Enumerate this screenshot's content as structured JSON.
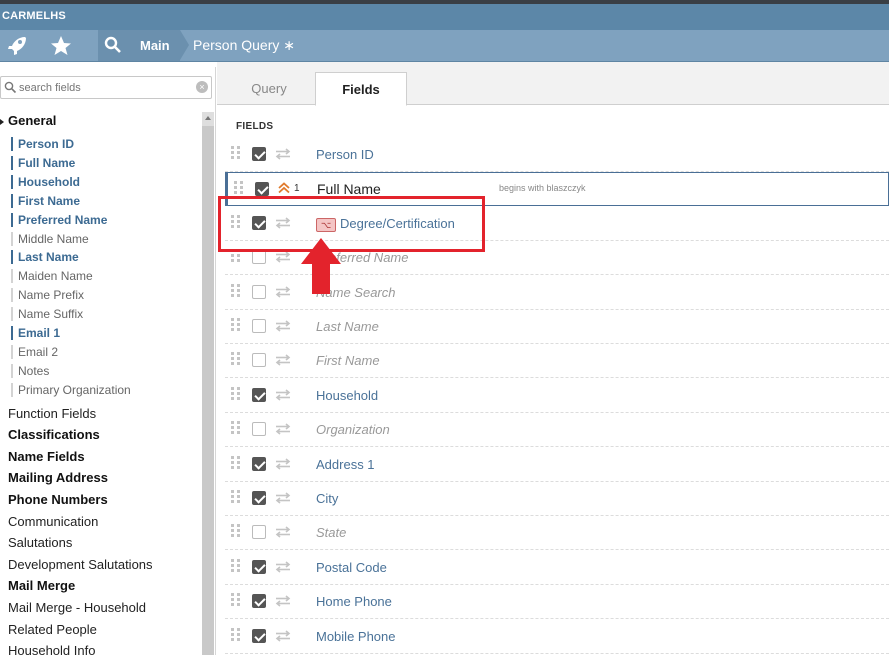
{
  "app": {
    "title": "CARMELHS"
  },
  "nav": {
    "main_label": "Main",
    "page_label": "Person Query ∗",
    "icons": [
      "rocket-icon",
      "star-icon",
      "search-icon"
    ]
  },
  "sidebar": {
    "search_placeholder": "search fields",
    "general_label": "General",
    "general_items": [
      {
        "label": "Person ID",
        "selected": true
      },
      {
        "label": "Full Name",
        "selected": true
      },
      {
        "label": "Household",
        "selected": true
      },
      {
        "label": "First Name",
        "selected": true
      },
      {
        "label": "Preferred Name",
        "selected": true
      },
      {
        "label": "Middle Name",
        "selected": false
      },
      {
        "label": "Last Name",
        "selected": true
      },
      {
        "label": "Maiden Name",
        "selected": false
      },
      {
        "label": "Name Prefix",
        "selected": false
      },
      {
        "label": "Name Suffix",
        "selected": false
      },
      {
        "label": "Email 1",
        "selected": true
      },
      {
        "label": "Email 2",
        "selected": false
      },
      {
        "label": "Notes",
        "selected": false
      },
      {
        "label": "Primary Organization",
        "selected": false
      }
    ],
    "groups": [
      {
        "label": "Function Fields",
        "bold": false
      },
      {
        "label": "Classifications",
        "bold": true
      },
      {
        "label": "Name Fields",
        "bold": true
      },
      {
        "label": "Mailing Address",
        "bold": true
      },
      {
        "label": "Phone Numbers",
        "bold": true
      },
      {
        "label": "Communication",
        "bold": false
      },
      {
        "label": "Salutations",
        "bold": false
      },
      {
        "label": "Development Salutations",
        "bold": false
      },
      {
        "label": "Mail Merge",
        "bold": true
      },
      {
        "label": "Mail Merge - Household",
        "bold": false
      },
      {
        "label": "Related People",
        "bold": false
      },
      {
        "label": "Household Info",
        "bold": false
      }
    ]
  },
  "tabs": {
    "query": "Query",
    "fields": "Fields"
  },
  "fields_heading": "FIELDS",
  "rows": [
    {
      "label": "Person ID",
      "checked": true,
      "enabled": true
    },
    {
      "label": "Full Name",
      "checked": true,
      "enabled": true,
      "sort": "1",
      "criteria": "begins with blaszczyk",
      "highlight": true
    },
    {
      "label": "Degree/Certification",
      "checked": true,
      "enabled": true,
      "function": true
    },
    {
      "label": "Preferred Name",
      "checked": false,
      "enabled": false
    },
    {
      "label": "Name Search",
      "checked": false,
      "enabled": false
    },
    {
      "label": "Last Name",
      "checked": false,
      "enabled": false
    },
    {
      "label": "First Name",
      "checked": false,
      "enabled": false
    },
    {
      "label": "Household",
      "checked": true,
      "enabled": true
    },
    {
      "label": "Organization",
      "checked": false,
      "enabled": false
    },
    {
      "label": "Address 1",
      "checked": true,
      "enabled": true
    },
    {
      "label": "City",
      "checked": true,
      "enabled": true
    },
    {
      "label": "State",
      "checked": false,
      "enabled": false
    },
    {
      "label": "Postal Code",
      "checked": true,
      "enabled": true
    },
    {
      "label": "Home Phone",
      "checked": true,
      "enabled": true
    },
    {
      "label": "Mobile Phone",
      "checked": true,
      "enabled": true
    }
  ],
  "function_icon_glyph": "⌥",
  "colors": {
    "accent": "#4a7298",
    "annotation": "#e3232c"
  }
}
